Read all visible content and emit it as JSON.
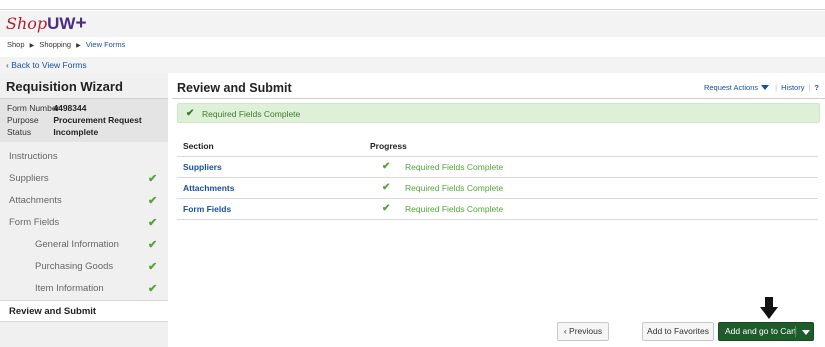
{
  "logo": {
    "shop": "Shop",
    "uw": "UW",
    "plus": "+"
  },
  "breadcrumb": {
    "items": [
      "Shop",
      "Shopping",
      "View Forms"
    ]
  },
  "back_link": "‹ Back to View Forms",
  "wizard": {
    "title": "Requisition Wizard",
    "form_info": [
      {
        "label": "Form Number",
        "value": "4498344"
      },
      {
        "label": "Purpose",
        "value": "Procurement Request"
      },
      {
        "label": "Status",
        "value": "Incomplete"
      }
    ],
    "nav": [
      {
        "label": "Instructions",
        "complete": false,
        "sub": false,
        "active": false
      },
      {
        "label": "Suppliers",
        "complete": true,
        "sub": false,
        "active": false
      },
      {
        "label": "Attachments",
        "complete": true,
        "sub": false,
        "active": false
      },
      {
        "label": "Form Fields",
        "complete": true,
        "sub": false,
        "active": false
      },
      {
        "label": "General Information",
        "complete": true,
        "sub": true,
        "active": false
      },
      {
        "label": "Purchasing Goods",
        "complete": true,
        "sub": true,
        "active": false
      },
      {
        "label": "Item Information",
        "complete": true,
        "sub": true,
        "active": false
      },
      {
        "label": "Review and Submit",
        "complete": false,
        "sub": false,
        "active": true
      }
    ]
  },
  "main": {
    "title": "Review and Submit",
    "request_actions": "Request Actions",
    "history": "History",
    "help": "?",
    "alert": "Required Fields Complete",
    "table": {
      "headers": [
        "Section",
        "Progress"
      ],
      "rows": [
        {
          "section": "Suppliers",
          "progress": "Required Fields Complete"
        },
        {
          "section": "Attachments",
          "progress": "Required Fields Complete"
        },
        {
          "section": "Form Fields",
          "progress": "Required Fields Complete"
        }
      ]
    }
  },
  "buttons": {
    "previous": "‹ Previous",
    "add_to_favorites": "Add to Favorites",
    "add_and_go_to_cart": "Add and go to Cart"
  },
  "icons": {
    "check": "check-icon",
    "arrow": "down-arrow-icon",
    "dropdown": "caret-down-icon"
  },
  "colors": {
    "brand_red": "#b01e32",
    "brand_purple": "#4b2e83",
    "link_blue": "#1a4fa0",
    "success_green": "#52a43a",
    "cart_button": "#1e5c2c"
  }
}
